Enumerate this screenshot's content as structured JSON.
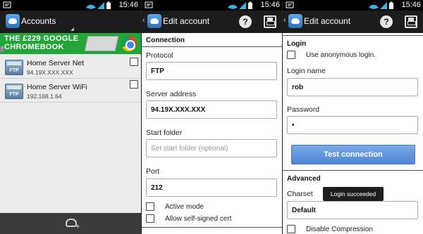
{
  "status": {
    "time": "15:46"
  },
  "screen1": {
    "title": "Accounts",
    "ad": {
      "text": "THE £229 GOOGLE CHROMEBOOK",
      "info_label": "i"
    },
    "accounts": [
      {
        "name": "Home Server Net",
        "address": "94.19X.XXX.XXX"
      },
      {
        "name": "Home Server WiFi",
        "address": "192.168.1.64"
      }
    ],
    "ftp_label": "FTP"
  },
  "screen2": {
    "title": "Edit account",
    "help_label": "?",
    "section_connection": "Connection",
    "protocol_label": "Protocol",
    "protocol_value": "FTP",
    "server_label": "Server address",
    "server_value": "94.19X.XXX.XXX",
    "start_folder_label": "Start folder",
    "start_folder_placeholder": "Set start folder (optional)",
    "port_label": "Port",
    "port_value": "212",
    "active_mode_label": "Active mode",
    "self_signed_label": "Allow self-signed cert"
  },
  "screen3": {
    "title": "Edit account",
    "help_label": "?",
    "section_login": "Login",
    "anonymous_label": "Use anonymous login.",
    "login_name_label": "Login name",
    "login_name_value": "rob",
    "password_label": "Password",
    "password_value": "•",
    "test_button": "Test connection",
    "section_advanced": "Advanced",
    "charset_label": "Charset",
    "charset_value": "Default",
    "toast": "Login succeeded",
    "disable_compression_label": "Disable Compression"
  }
}
